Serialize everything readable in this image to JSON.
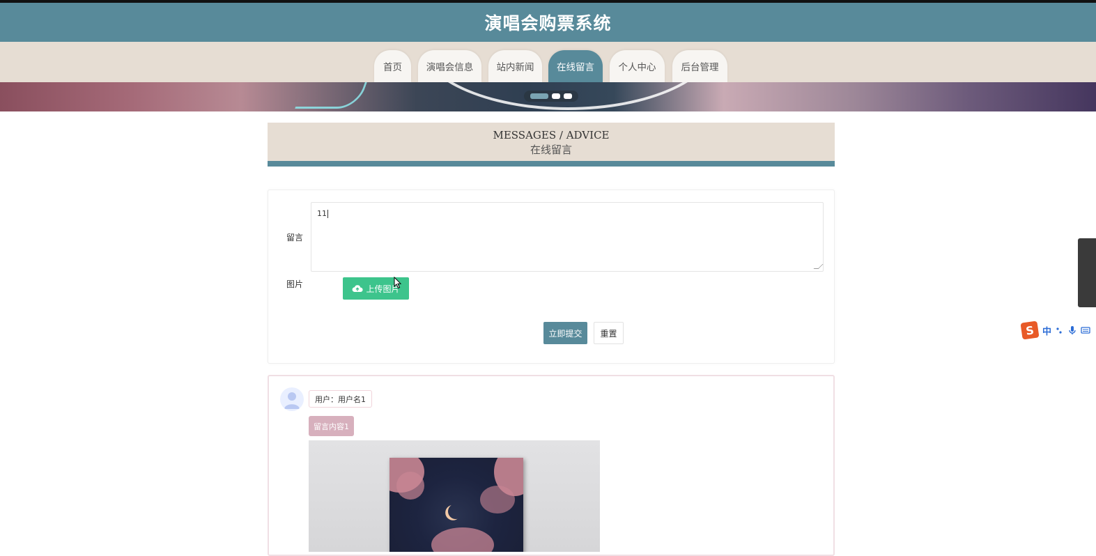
{
  "header": {
    "title": "演唱会购票系统"
  },
  "nav": {
    "items": [
      {
        "label": "首页",
        "active": false
      },
      {
        "label": "演唱会信息",
        "active": false
      },
      {
        "label": "站内新闻",
        "active": false
      },
      {
        "label": "在线留言",
        "active": true
      },
      {
        "label": "个人中心",
        "active": false
      },
      {
        "label": "后台管理",
        "active": false
      }
    ]
  },
  "carousel": {
    "slide_count": 3,
    "active_index": 0
  },
  "section": {
    "title_en": "MESSAGES / ADVICE",
    "title_cn": "在线留言"
  },
  "form": {
    "message_label": "留言",
    "message_value": "11",
    "image_label": "图片",
    "upload_label": "上传图片",
    "submit_label": "立即提交",
    "reset_label": "重置"
  },
  "messages": [
    {
      "user_label": "用户：用户名1",
      "content": "留言内容1"
    }
  ],
  "ime": {
    "mode": "中",
    "icons": [
      "punctuation-icon",
      "mic-icon",
      "keyboard-icon"
    ]
  },
  "colors": {
    "primary": "#588a9a",
    "nav_bg": "#e6ddd3",
    "upload_green": "#3dc48c",
    "message_pink": "#d7b0bd"
  }
}
